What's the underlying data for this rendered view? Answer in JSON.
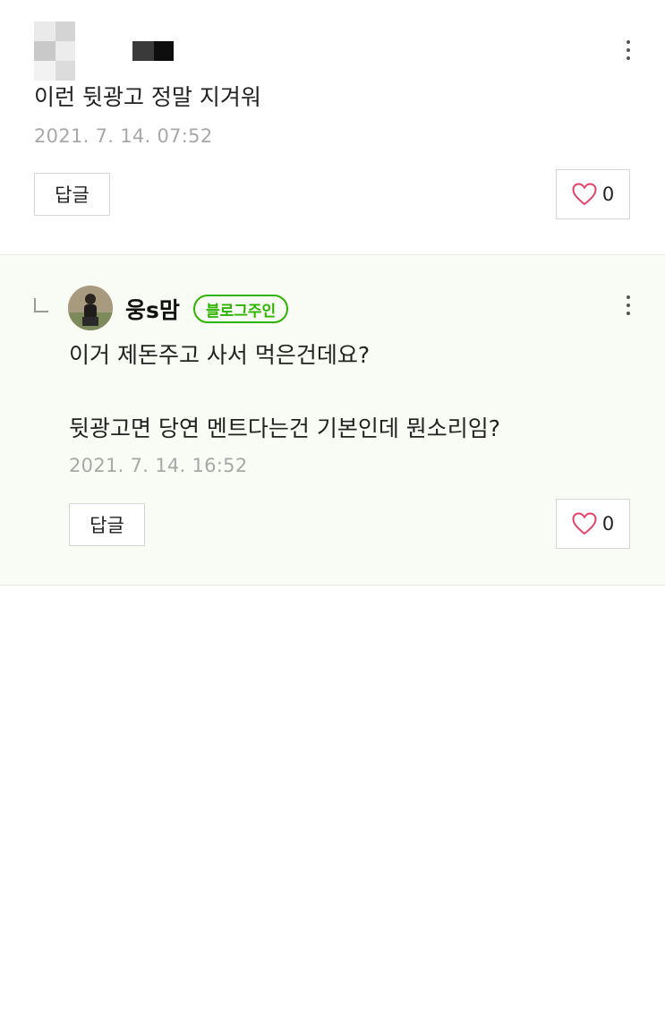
{
  "comments": [
    {
      "text": "이런 뒷광고 정말 지겨워",
      "date": "2021. 7. 14. 07:52",
      "reply_label": "답글",
      "like_count": "0"
    }
  ],
  "reply": {
    "author": "웅s맘",
    "badge": "블로그주인",
    "text_line1": "이거 제돈주고 사서 먹은건데요?",
    "text_line2": "뒷광고면 당연 멘트다는건 기본인데 뭔소리임?",
    "date": "2021. 7. 14. 16:52",
    "reply_label": "답글",
    "like_count": "0"
  },
  "colors": {
    "badge_green": "#2db400",
    "heart_pink": "#e0446b",
    "reply_bg": "#f9fbf5"
  },
  "icons": {
    "more": "more-vertical-icon",
    "like": "heart-outline-icon",
    "reply_indicator": "reply-corner-icon"
  }
}
